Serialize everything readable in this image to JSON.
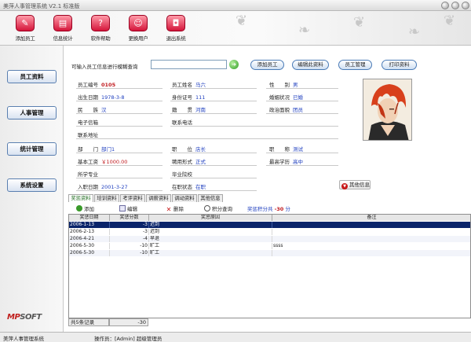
{
  "window": {
    "title": "美萍人事管理系统 V2.1 标准版"
  },
  "toolbar": [
    {
      "label": "添加员工",
      "icon": "add-employee-icon"
    },
    {
      "label": "信息统计",
      "icon": "statistics-icon"
    },
    {
      "label": "软件帮助",
      "icon": "help-icon"
    },
    {
      "label": "更换用户",
      "icon": "switch-user-icon"
    },
    {
      "label": "退出系统",
      "icon": "exit-icon"
    }
  ],
  "nav": [
    {
      "label": "员工资料"
    },
    {
      "label": "人事管理"
    },
    {
      "label": "统计管理"
    },
    {
      "label": "系统设置"
    }
  ],
  "logo": {
    "mark": "MP",
    "rest": "SOFT"
  },
  "search": {
    "label": "可输入员工信息进行模糊查询",
    "value": "",
    "go_icon": "go-arrow-icon",
    "buttons": [
      "添加员工",
      "编辑此资料",
      "员工管理",
      "打印资料"
    ]
  },
  "employee": {
    "id_label": "员工编号",
    "id": "0105",
    "name_label": "员工姓名",
    "name": "马六",
    "gender_label": "性　　别",
    "gender": "男",
    "birth_label": "出生日期",
    "birth": "1978-3-8",
    "idcard_label": "身份证号",
    "idcard": "111",
    "marital_label": "婚姻状况",
    "marital": "已婚",
    "ethnic_label": "民　　族",
    "ethnic": "汉",
    "origin_label": "籍　　贯",
    "origin": "河南",
    "political_label": "政治面貌",
    "political": "团员",
    "email_label": "电子信箱",
    "email": "",
    "phone_label": "联系电话",
    "phone": "",
    "address_label": "联系地址",
    "address": "",
    "dept_label": "部　　门",
    "dept": "部门1",
    "position_label": "职　　位",
    "position": "店长",
    "title_label": "职　　称",
    "title": "测试",
    "salary_label": "基本工资",
    "salary": "￥1000.00",
    "hire_form_label": "聘用形式",
    "hire_form": "正式",
    "edu_label": "最高学历",
    "edu": "高中",
    "major_label": "所学专业",
    "major": "",
    "school_label": "毕业院校",
    "school": "",
    "entry_label": "入职日期",
    "entry": "2001-3-27",
    "status_label": "在职状态",
    "status": "在职"
  },
  "other_info_button": "其他信息",
  "tabs": [
    "奖惩资料",
    "培训资料",
    "考评资料",
    "调薪资料",
    "调动资料",
    "其他信息"
  ],
  "record_actions": {
    "add": "添加",
    "edit": "编辑",
    "delete": "删除",
    "query": "积分查询",
    "total_label": "奖惩积分共",
    "total_value": "-30",
    "total_unit": "分"
  },
  "table": {
    "headers": [
      "奖惩日期",
      "奖惩分数",
      "奖惩原因",
      "备注"
    ],
    "rows": [
      [
        "2006-1-13",
        "-3",
        "迟到",
        ""
      ],
      [
        "2006-2-13",
        "-3",
        "迟到",
        ""
      ],
      [
        "2006-4-21",
        "-4",
        "早退",
        ""
      ],
      [
        "2006-5-30",
        "-10",
        "旷工",
        "ssss"
      ],
      [
        "2006-5-30",
        "-10",
        "旷工",
        ""
      ]
    ]
  },
  "footer": {
    "count": "共5条记录",
    "sum": "-30"
  },
  "statusbar": {
    "app": "美萍人事管理系统",
    "operator": "操作员：[Admin] 超级管理员"
  }
}
